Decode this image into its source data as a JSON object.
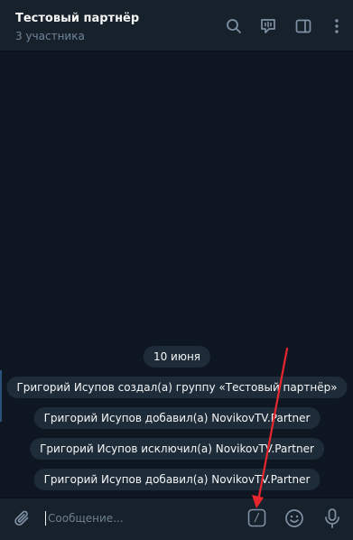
{
  "chat": {
    "title": "Тестовый партнёр",
    "subtitle": "3 участника"
  },
  "header_icons": [
    "search-icon",
    "video-chat-icon",
    "sidebar-toggle-icon",
    "more-menu-icon"
  ],
  "messages": {
    "date_separator": "10 июня",
    "service_messages": [
      "Григорий Исупов создал(а) группу «Тестовый партнёр»",
      "Григорий Исупов добавил(а) NovikovTV.Partner",
      "Григорий Исупов исключил(а) NovikovTV.Partner",
      "Григорий Исупов добавил(а) NovikovTV.Partner"
    ]
  },
  "composer": {
    "placeholder": "Сообщение...",
    "command_button_label": "/",
    "icons": [
      "attach-icon",
      "bot-commands-icon",
      "emoji-icon",
      "microphone-icon"
    ]
  },
  "annotation": {
    "arrow_color": "#e8262d"
  },
  "colors": {
    "background": "#0e1621",
    "header": "#17212b",
    "service_pill": "#1e2c3a",
    "icon": "#7f91a4"
  }
}
